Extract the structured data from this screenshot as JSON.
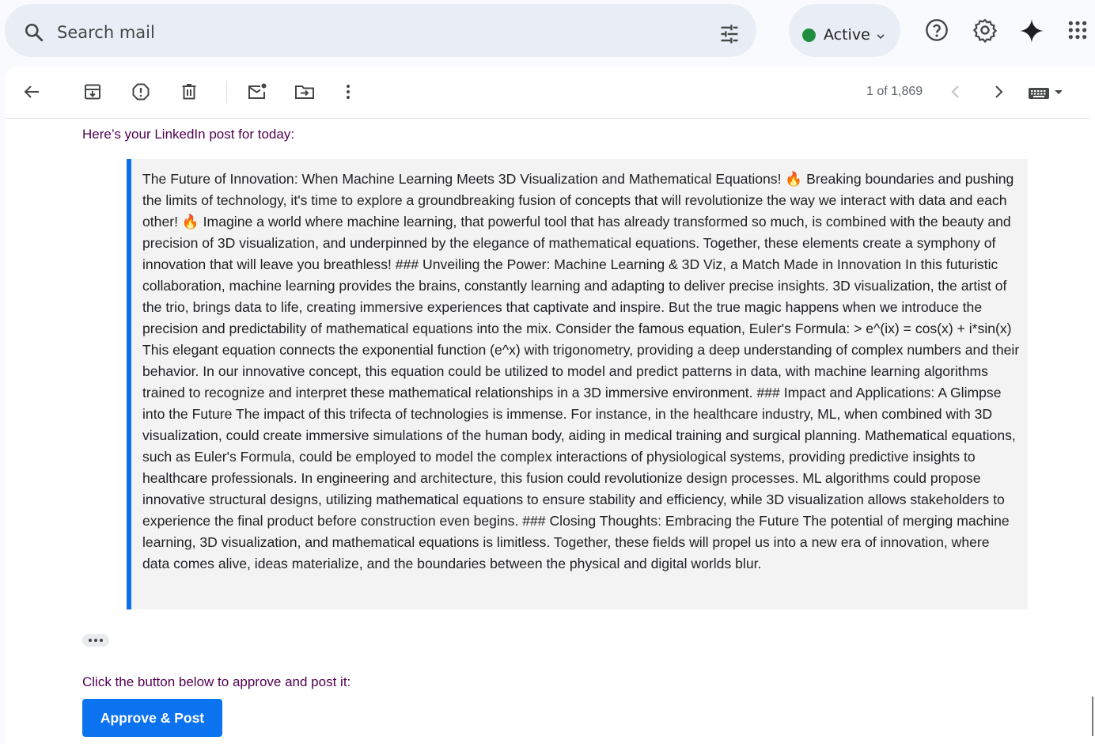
{
  "search": {
    "placeholder": "Search mail",
    "icon": "search-icon",
    "filter_icon": "tune-icon"
  },
  "status": {
    "label": "Active",
    "color": "#1e8e3e"
  },
  "header_icons": [
    "help-icon",
    "settings-icon",
    "gemini-icon",
    "apps-icon"
  ],
  "toolbar": {
    "icons": [
      "back-arrow-icon",
      "archive-icon",
      "report-spam-icon",
      "delete-icon",
      "mark-unread-icon",
      "move-to-icon",
      "more-vert-icon"
    ],
    "counter": "1 of 1,869",
    "nav": [
      "chevron-left-icon",
      "chevron-right-icon",
      "keyboard-icon"
    ]
  },
  "email": {
    "intro": "Here’s your LinkedIn post for today:",
    "post": "The Future of Innovation: When Machine Learning Meets 3D Visualization and Mathematical Equations! 🔥 Breaking boundaries and pushing the limits of technology, it's time to explore a groundbreaking fusion of concepts that will revolutionize the way we interact with data and each other! 🔥 Imagine a world where machine learning, that powerful tool that has already transformed so much, is combined with the beauty and precision of 3D visualization, and underpinned by the elegance of mathematical equations. Together, these elements create a symphony of innovation that will leave you breathless! ### Unveiling the Power: Machine Learning & 3D Viz, a Match Made in Innovation In this futuristic collaboration, machine learning provides the brains, constantly learning and adapting to deliver precise insights. 3D visualization, the artist of the trio, brings data to life, creating immersive experiences that captivate and inspire. But the true magic happens when we introduce the precision and predictability of mathematical equations into the mix. Consider the famous equation, Euler's Formula: > e^(ix) = cos(x) + i*sin(x) This elegant equation connects the exponential function (e^x) with trigonometry, providing a deep understanding of complex numbers and their behavior. In our innovative concept, this equation could be utilized to model and predict patterns in data, with machine learning algorithms trained to recognize and interpret these mathematical relationships in a 3D immersive environment. ### Impact and Applications: A Glimpse into the Future The impact of this trifecta of technologies is immense. For instance, in the healthcare industry, ML, when combined with 3D visualization, could create immersive simulations of the human body, aiding in medical training and surgical planning. Mathematical equations, such as Euler's Formula, could be employed to model the complex interactions of physiological systems, providing predictive insights to healthcare professionals. In engineering and architecture, this fusion could revolutionize design processes. ML algorithms could propose innovative structural designs, utilizing mathematical equations to ensure stability and efficiency, while 3D visualization allows stakeholders to experience the final product before construction even begins. ### Closing Thoughts: Embracing the Future The potential of merging machine learning, 3D visualization, and mathematical equations is limitless. Together, these fields will propel us into a new era of innovation, where data comes alive, ideas materialize, and the boundaries between the physical and digital worlds blur.",
    "cta_text": "Click the button below to approve and post it:",
    "cta_button": "Approve & Post",
    "accent": "#0b72f0",
    "intro_color": "#500050"
  }
}
